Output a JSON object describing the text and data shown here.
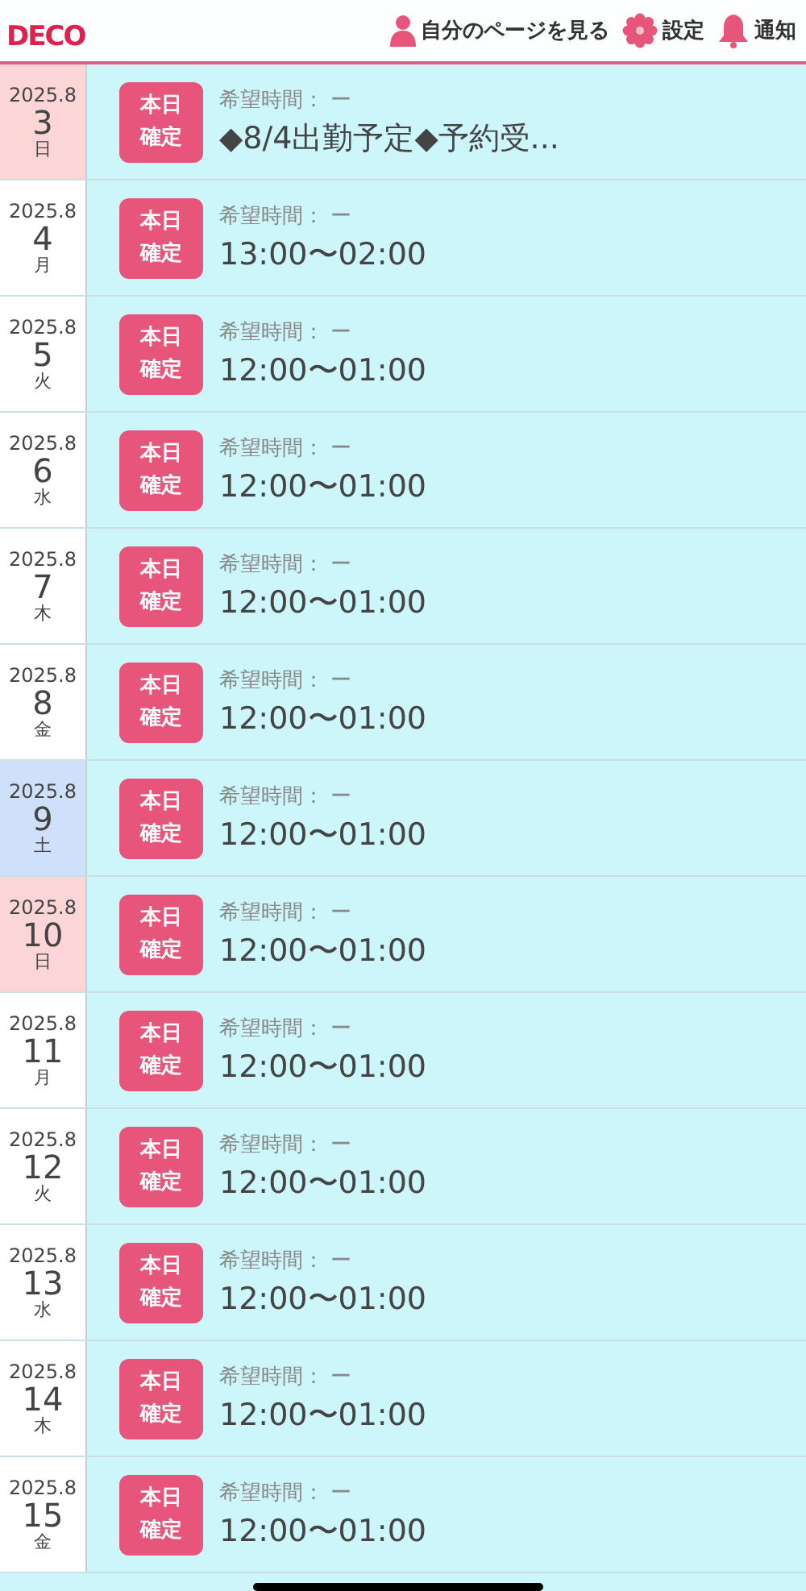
{
  "header": {
    "logo": "DECO",
    "nav": [
      {
        "kind": "person",
        "label": "自分のページを見る"
      },
      {
        "kind": "gear",
        "label": "設定"
      },
      {
        "kind": "bell",
        "label": "通知"
      }
    ]
  },
  "days": [
    {
      "month": "2025.8",
      "day": "3",
      "weekday": "日",
      "kind": "sunday",
      "badge": "本日確定",
      "label": "希望時間： ー",
      "value": "◆8/4出勤予定◆予約受..."
    },
    {
      "month": "2025.8",
      "day": "4",
      "weekday": "月",
      "kind": "weekday",
      "badge": "本日確定",
      "label": "希望時間： ー",
      "value": "13:00〜02:00"
    },
    {
      "month": "2025.8",
      "day": "5",
      "weekday": "火",
      "kind": "weekday",
      "badge": "本日確定",
      "label": "希望時間： ー",
      "value": "12:00〜01:00"
    },
    {
      "month": "2025.8",
      "day": "6",
      "weekday": "水",
      "kind": "weekday",
      "badge": "本日確定",
      "label": "希望時間： ー",
      "value": "12:00〜01:00"
    },
    {
      "month": "2025.8",
      "day": "7",
      "weekday": "木",
      "kind": "weekday",
      "badge": "本日確定",
      "label": "希望時間： ー",
      "value": "12:00〜01:00"
    },
    {
      "month": "2025.8",
      "day": "8",
      "weekday": "金",
      "kind": "weekday",
      "badge": "本日確定",
      "label": "希望時間： ー",
      "value": "12:00〜01:00"
    },
    {
      "month": "2025.8",
      "day": "9",
      "weekday": "土",
      "kind": "saturday",
      "badge": "本日確定",
      "label": "希望時間： ー",
      "value": "12:00〜01:00"
    },
    {
      "month": "2025.8",
      "day": "10",
      "weekday": "日",
      "kind": "sunday",
      "badge": "本日確定",
      "label": "希望時間： ー",
      "value": "12:00〜01:00"
    },
    {
      "month": "2025.8",
      "day": "11",
      "weekday": "月",
      "kind": "weekday",
      "badge": "本日確定",
      "label": "希望時間： ー",
      "value": "12:00〜01:00"
    },
    {
      "month": "2025.8",
      "day": "12",
      "weekday": "火",
      "kind": "weekday",
      "badge": "本日確定",
      "label": "希望時間： ー",
      "value": "12:00〜01:00"
    },
    {
      "month": "2025.8",
      "day": "13",
      "weekday": "水",
      "kind": "weekday",
      "badge": "本日確定",
      "label": "希望時間： ー",
      "value": "12:00〜01:00"
    },
    {
      "month": "2025.8",
      "day": "14",
      "weekday": "木",
      "kind": "weekday",
      "badge": "本日確定",
      "label": "希望時間： ー",
      "value": "12:00〜01:00"
    },
    {
      "month": "2025.8",
      "day": "15",
      "weekday": "金",
      "kind": "weekday",
      "badge": "本日確定",
      "label": "希望時間： ー",
      "value": "12:00〜01:00"
    }
  ]
}
